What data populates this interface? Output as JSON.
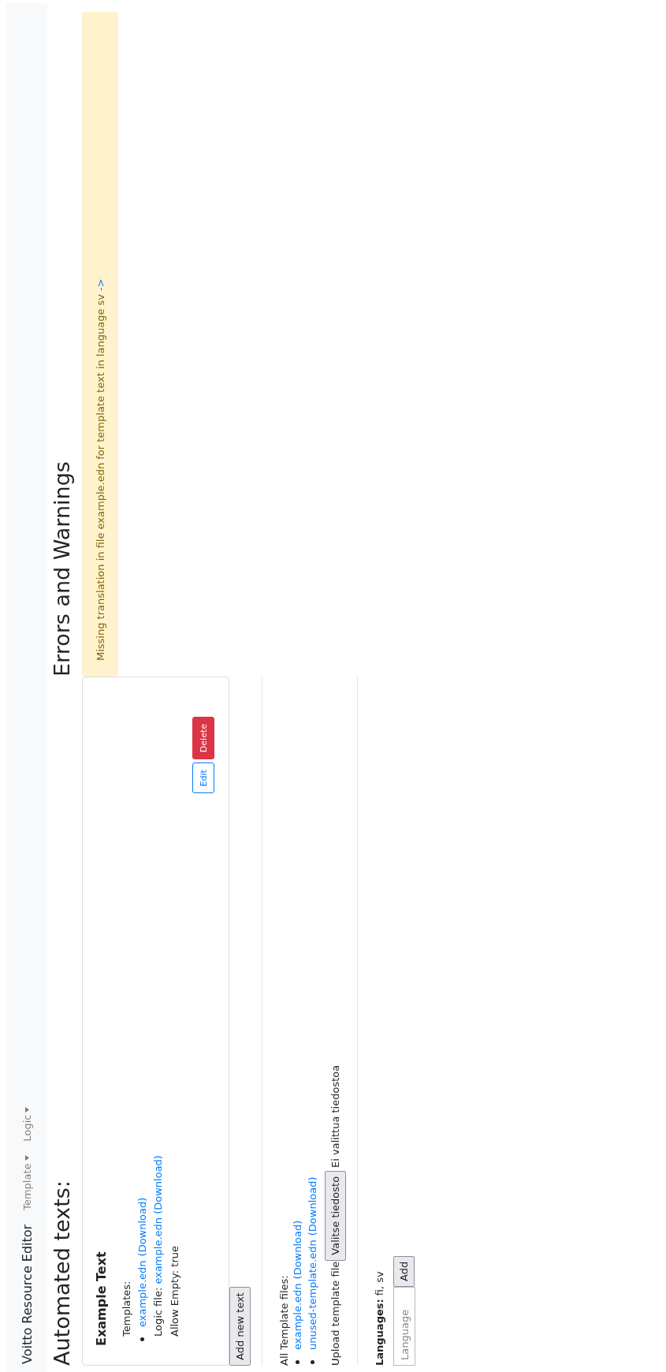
{
  "navbar": {
    "brand": "Voitto Resource Editor",
    "menus": [
      {
        "label": "Template"
      },
      {
        "label": "Logic"
      }
    ]
  },
  "automated_texts": {
    "title": "Automated texts:",
    "texts": [
      {
        "name": "Example Text",
        "templates_label": "Templates:",
        "templates": [
          {
            "file": "example.edn",
            "download": "(Download)"
          }
        ],
        "logic_label": "Logic file:",
        "logic_file": "example.edn",
        "logic_download": "(Download)",
        "allow_empty": "Allow Empty: true",
        "edit": "Edit",
        "delete": "Delete"
      }
    ],
    "add_button": "Add new text"
  },
  "template_files": {
    "label": "All Template files:",
    "files": [
      {
        "file": "example.edn",
        "download": "(Download)"
      },
      {
        "file": "unused-template.edn",
        "download": "(Download)"
      }
    ],
    "upload_label": "Upload template file",
    "choose_button": "Valitse tiedosto",
    "no_file": "Ei valittua tiedostoa"
  },
  "languages": {
    "label": "**Languages:** fi, sv",
    "input_placeholder": "Language",
    "add_button": "Add"
  },
  "errors": {
    "title": "Errors and Warnings",
    "warnings": [
      {
        "text": "Missing translation in file example.edn for template text in language sv",
        "link": "->"
      }
    ]
  }
}
